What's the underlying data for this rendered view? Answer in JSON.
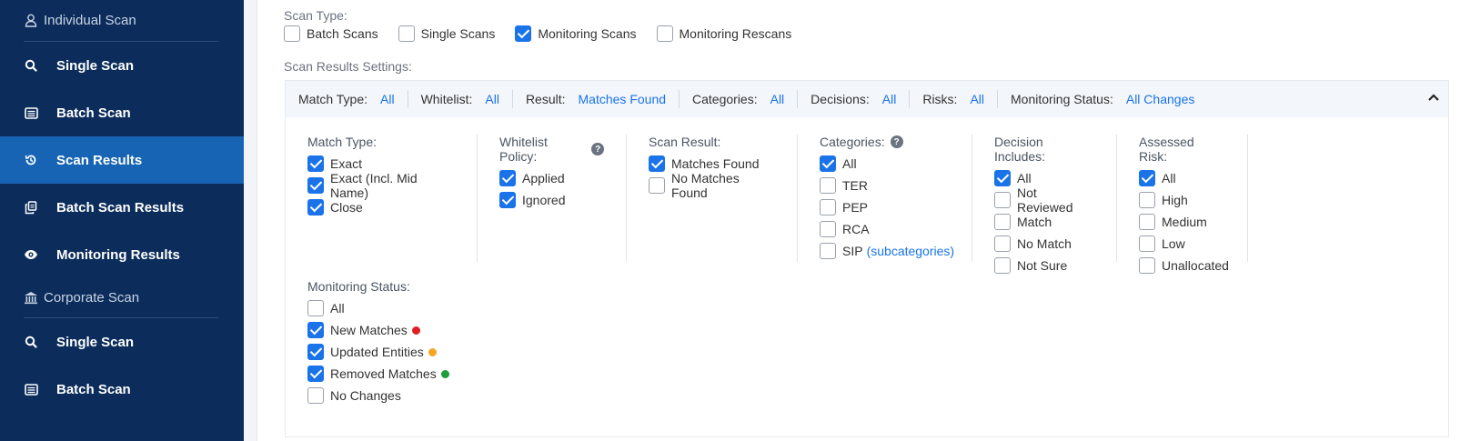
{
  "sidebar": {
    "individual_header": "Individual Scan",
    "individual_items": [
      {
        "label": "Single Scan",
        "icon": "search-icon"
      },
      {
        "label": "Batch Scan",
        "icon": "batch-icon"
      },
      {
        "label": "Scan Results",
        "icon": "history-icon",
        "active": true
      },
      {
        "label": "Batch Scan Results",
        "icon": "copy-icon"
      },
      {
        "label": "Monitoring Results",
        "icon": "eye-icon"
      }
    ],
    "corporate_header": "Corporate Scan",
    "corporate_items": [
      {
        "label": "Single Scan",
        "icon": "search-icon"
      },
      {
        "label": "Batch Scan",
        "icon": "batch-icon"
      }
    ]
  },
  "scan_type": {
    "label": "Scan Type:",
    "options": [
      {
        "label": "Batch Scans",
        "checked": false
      },
      {
        "label": "Single Scans",
        "checked": false
      },
      {
        "label": "Monitoring Scans",
        "checked": true
      },
      {
        "label": "Monitoring Rescans",
        "checked": false
      }
    ]
  },
  "settings": {
    "label": "Scan Results Settings:",
    "summary": [
      {
        "key": "Match Type:",
        "value": "All"
      },
      {
        "key": "Whitelist:",
        "value": "All"
      },
      {
        "key": "Result:",
        "value": "Matches Found"
      },
      {
        "key": "Categories:",
        "value": "All"
      },
      {
        "key": "Decisions:",
        "value": "All"
      },
      {
        "key": "Risks:",
        "value": "All"
      },
      {
        "key": "Monitoring Status:",
        "value": "All Changes"
      }
    ],
    "groups": [
      {
        "title": "Match Type:",
        "help": false,
        "options": [
          {
            "label": "Exact",
            "checked": true
          },
          {
            "label": "Exact (Incl. Mid Name)",
            "checked": true
          },
          {
            "label": "Close",
            "checked": true
          }
        ]
      },
      {
        "title": "Whitelist Policy:",
        "help": true,
        "options": [
          {
            "label": "Applied",
            "checked": true
          },
          {
            "label": "Ignored",
            "checked": true
          }
        ]
      },
      {
        "title": "Scan Result:",
        "help": false,
        "options": [
          {
            "label": "Matches Found",
            "checked": true
          },
          {
            "label": "No Matches Found",
            "checked": false
          }
        ]
      },
      {
        "title": "Categories:",
        "help": true,
        "options": [
          {
            "label": "All",
            "checked": true
          },
          {
            "label": "TER",
            "checked": false
          },
          {
            "label": "PEP",
            "checked": false
          },
          {
            "label": "RCA",
            "checked": false
          },
          {
            "label": "SIP",
            "checked": false,
            "link": "(subcategories)"
          }
        ]
      },
      {
        "title": "Decision Includes:",
        "help": false,
        "options": [
          {
            "label": "All",
            "checked": true
          },
          {
            "label": "Not Reviewed",
            "checked": false
          },
          {
            "label": "Match",
            "checked": false
          },
          {
            "label": "No Match",
            "checked": false
          },
          {
            "label": "Not Sure",
            "checked": false
          }
        ]
      },
      {
        "title": "Assessed Risk:",
        "help": false,
        "options": [
          {
            "label": "All",
            "checked": true
          },
          {
            "label": "High",
            "checked": false
          },
          {
            "label": "Medium",
            "checked": false
          },
          {
            "label": "Low",
            "checked": false
          },
          {
            "label": "Unallocated",
            "checked": false
          }
        ]
      }
    ],
    "monitoring": {
      "title": "Monitoring Status:",
      "options": [
        {
          "label": "All",
          "checked": false,
          "dot": null
        },
        {
          "label": "New Matches",
          "checked": true,
          "dot": "#e02020"
        },
        {
          "label": "Updated Entities",
          "checked": true,
          "dot": "#f5a623"
        },
        {
          "label": "Removed Matches",
          "checked": true,
          "dot": "#1e9e3a"
        },
        {
          "label": "No Changes",
          "checked": false,
          "dot": null
        }
      ]
    }
  },
  "colors": {
    "sidebar_bg": "#0c2d5b",
    "active_bg": "#1864b4",
    "accent": "#1a73e8"
  }
}
